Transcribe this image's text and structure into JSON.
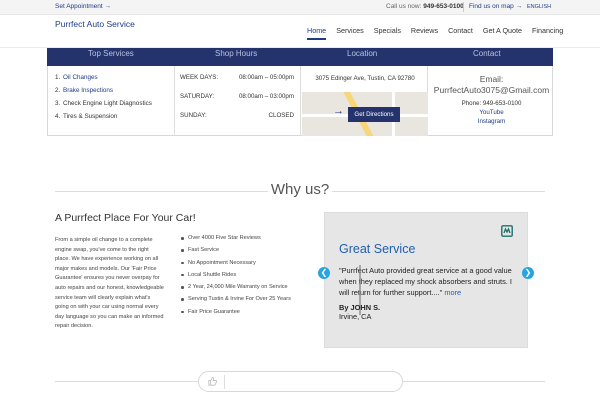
{
  "topbar": {
    "appointment": "Set Appointment →",
    "call_label": "Call us now:",
    "call_number": "949-653-0100",
    "find_map": "Find us on map →",
    "language": "ENGLISH"
  },
  "header": {
    "logo": "Purrfect Auto Service",
    "nav": [
      "Home",
      "Services",
      "Specials",
      "Reviews",
      "Contact",
      "Get A Quote",
      "Financing"
    ]
  },
  "info": {
    "headers": [
      "Top Services",
      "Shop Hours",
      "Location",
      "Contact"
    ],
    "services": [
      {
        "num": "1.",
        "label": "Oil Changes"
      },
      {
        "num": "2.",
        "label": "Brake Inspections"
      },
      {
        "num": "3.",
        "label": "Check Engine Light Diagnostics"
      },
      {
        "num": "4.",
        "label": "Tires & Suspension"
      }
    ],
    "hours": [
      {
        "day": "WEEK DAYS:",
        "time": "08:00am – 05:00pm"
      },
      {
        "day": "SATURDAY:",
        "time": "08:00am – 03:00pm"
      },
      {
        "day": "SUNDAY:",
        "time": "CLOSED"
      }
    ],
    "address": "3075 Edinger Ave, Tustin, CA 92780",
    "directions": "Get Directions",
    "contact": {
      "email_label": "Email:",
      "email": "PurrfectAuto3075@Gmail.com",
      "phone": "Phone: 949-653-0100",
      "youtube": "YouTube",
      "instagram": "Instagram"
    }
  },
  "why": {
    "title": "Why us?",
    "subtitle": "A Purrfect Place For Your Car!",
    "paragraph": "From a simple oil change to a complete engine swap, you've come to the right place. We have experience working on all major makes and models. Our 'Fair Price Guarantee' ensures you never overpay for auto repairs and our honest, knowledgeable service team will clearly explain what's going on with your car using normal every day language so you can make an informed repair decision.",
    "features": [
      "Over 4000 Five Star Reviews",
      "Fast Service",
      "No Appointment Necessary",
      "Local Shuttle Rides",
      "2 Year, 24,000 Mile Warranty on Service",
      "Serving Tustin & Irvine For Over 25 Years",
      "Fair Price Guarantee"
    ]
  },
  "testimonial": {
    "heading": "Great Service",
    "quote": "\"Purrfect Auto provided great service at a good value when they replaced my shock absorbers and struts. I will return for further support....\"",
    "more": "more",
    "name": "By JOHN S.",
    "location": "Irvine, CA"
  },
  "colors": {
    "brand_navy": "#25336c",
    "link_blue": "#1f3b86",
    "accent_blue": "#2aa4e0"
  }
}
